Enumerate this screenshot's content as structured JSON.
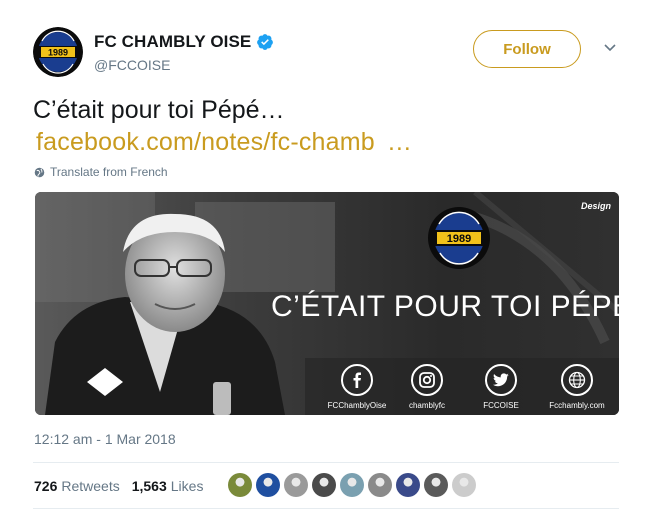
{
  "account": {
    "display_name": "FC CHAMBLY OISE",
    "handle": "@FCCOISE",
    "avatar_year": "1989",
    "verified": true
  },
  "follow_button": {
    "label": "Follow"
  },
  "tweet": {
    "text": "C’était pour toi Pépé…",
    "link_text": "facebook.com/notes/fc-chamb",
    "link_ellipsis": "…",
    "translate_label": "Translate from French"
  },
  "media": {
    "headline": "C’ÉTAIT POUR TOI PÉPÉ…",
    "brand": "Design",
    "logo_year": "1989",
    "socials": [
      {
        "icon": "facebook-icon",
        "label": "FCChamblyOise"
      },
      {
        "icon": "instagram-icon",
        "label": "chamblyfc"
      },
      {
        "icon": "twitter-icon",
        "label": "FCCOISE"
      },
      {
        "icon": "globe-icon",
        "label": "Fcchambly.com"
      }
    ]
  },
  "timestamp": "12:12 am - 1 Mar 2018",
  "stats": {
    "retweets_count": "726",
    "retweets_label": "Retweets",
    "likes_count": "1,563",
    "likes_label": "Likes"
  },
  "likers": [
    {
      "color": "#7a8a3a"
    },
    {
      "color": "#1f4fa0"
    },
    {
      "color": "#9a9a9a"
    },
    {
      "color": "#4a4a4a"
    },
    {
      "color": "#7aa0b0"
    },
    {
      "color": "#8a8a8a"
    },
    {
      "color": "#3a4a8a"
    },
    {
      "color": "#5a5a5a"
    },
    {
      "color": "#cccccc"
    }
  ],
  "colors": {
    "accent": "#c99b1f",
    "muted": "#657786",
    "verified": "#1da1f2"
  }
}
